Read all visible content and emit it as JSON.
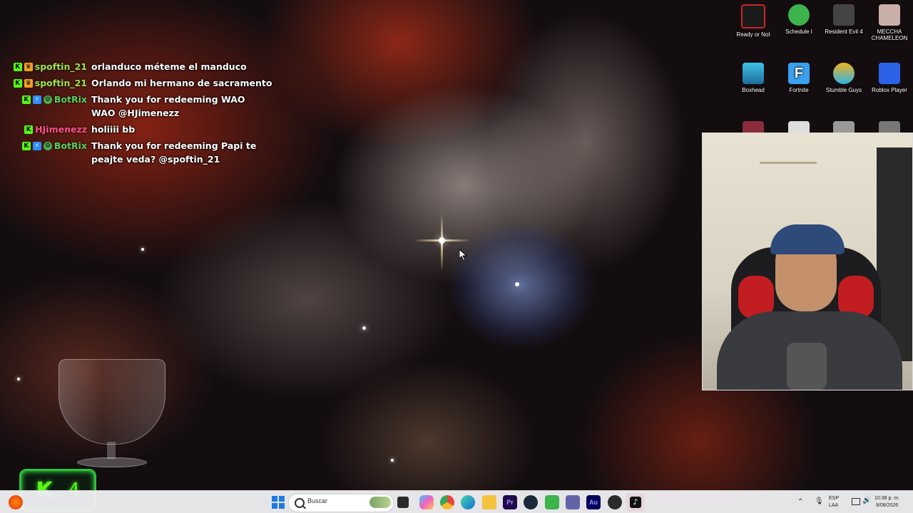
{
  "chat": [
    {
      "user": "spoftin_21",
      "color": "#9ee34a",
      "badges": [
        "K",
        "crown"
      ],
      "text": "orlanduco méteme el manduco"
    },
    {
      "user": "spoftin_21",
      "color": "#9ee34a",
      "badges": [
        "K",
        "crown"
      ],
      "text": "Orlando mi hermano de sacramento"
    },
    {
      "user": "BotRix",
      "color": "#58d05a",
      "badges": [
        "K",
        "bot",
        "gear"
      ],
      "text": "Thank you for redeeming WAO WAO @HJimenezz"
    },
    {
      "user": "HJimenezz",
      "color": "#ff4f8b",
      "badges": [
        "K"
      ],
      "text": "holiiii bb"
    },
    {
      "user": "BotRix",
      "color": "#58d05a",
      "badges": [
        "K",
        "bot",
        "gear"
      ],
      "text": "Thank you for redeeming Papi te peajte veda? @spoftin_21"
    }
  ],
  "desktop_icons": [
    {
      "label": "Ready or Not",
      "color": "#c9262b"
    },
    {
      "label": "Schedule I",
      "color": "#3cb44b"
    },
    {
      "label": "Resident Evil 4",
      "color": "#444444"
    },
    {
      "label": "MECCHA CHAMELEON",
      "color": "#c8b0a8"
    },
    {
      "label": "Boxhead",
      "color": "#2fa3c9"
    },
    {
      "label": "Fortnite",
      "color": "#3aa0f0"
    },
    {
      "label": "Stumble Guys",
      "color": "#f2b21c"
    },
    {
      "label": "Roblox Player",
      "color": "#2c62e8"
    }
  ],
  "counter": {
    "symbol": "K",
    "value": "4"
  },
  "taskbar": {
    "search_placeholder": "Buscar",
    "language": "ESP",
    "keyboard": "LAA",
    "time": "10:38 p. m.",
    "date": "9/08/2026"
  },
  "icons": {
    "start": "windows-icon",
    "search": "search-icon",
    "task_view": "task-view-icon",
    "apps": [
      "copilot-icon",
      "chrome-icon",
      "edge-icon",
      "file-explorer-icon",
      "premiere-icon",
      "steam-icon",
      "xbox-icon",
      "teams-icon",
      "audition-icon",
      "obs-icon",
      "tiktok-icon"
    ],
    "tray": [
      "chevron-up-icon",
      "microphone-icon",
      "network-icon",
      "volume-icon"
    ]
  }
}
